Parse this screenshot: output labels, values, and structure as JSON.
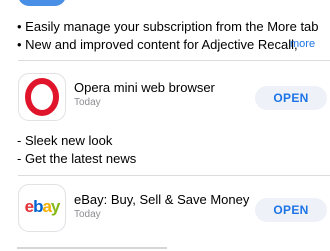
{
  "notes_top": {
    "line1": "• Easily manage your subscription from the More tab",
    "line2": "• New and improved content for Adjective Recall,",
    "more_label": "more"
  },
  "apps": [
    {
      "name": "Opera mini web browser",
      "date": "Today",
      "open_label": "OPEN",
      "icon": "opera-logo",
      "notes": [
        "- Sleek new look",
        "- Get the latest news"
      ]
    },
    {
      "name": "eBay: Buy, Sell & Save Money",
      "date": "Today",
      "open_label": "OPEN",
      "icon": "ebay-logo",
      "logo_text": "ebay"
    }
  ],
  "colors": {
    "accent": "#1e74e6",
    "button_bg": "#eef1f8",
    "opera_red": "#e0152b",
    "ebay_e": "#e53238",
    "ebay_b": "#0064d2",
    "ebay_a": "#f5af02",
    "ebay_y": "#86b817"
  }
}
